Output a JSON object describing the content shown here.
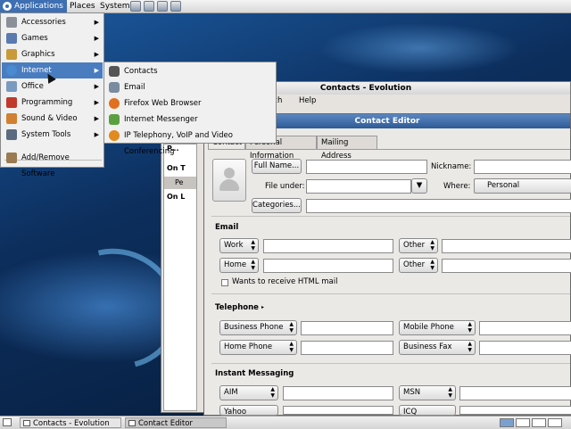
{
  "top_panel": {
    "menus": [
      "Applications",
      "Places",
      "System"
    ]
  },
  "applications_menu": {
    "items": [
      {
        "label": "Accessories",
        "icon": "accessories-icon",
        "color": "#8a8f99"
      },
      {
        "label": "Games",
        "icon": "games-icon",
        "color": "#5a7ab0"
      },
      {
        "label": "Graphics",
        "icon": "graphics-icon",
        "color": "#c89a3a"
      },
      {
        "label": "Internet",
        "icon": "globe-icon",
        "color": "#4a8ad0"
      },
      {
        "label": "Office",
        "icon": "office-icon",
        "color": "#7a9ac0"
      },
      {
        "label": "Programming",
        "icon": "programming-icon",
        "color": "#c0392b"
      },
      {
        "label": "Sound & Video",
        "icon": "sound-video-icon",
        "color": "#d08030"
      },
      {
        "label": "System Tools",
        "icon": "system-tools-icon",
        "color": "#5a6a80"
      },
      {
        "label": "Add/Remove Software",
        "icon": "package-icon",
        "color": "#9a7a50"
      }
    ],
    "highlighted": "Internet"
  },
  "internet_menu": {
    "items": [
      {
        "label": "Contacts",
        "icon": "contacts-icon",
        "color": "#555555"
      },
      {
        "label": "Email",
        "icon": "email-icon",
        "color": "#7a8aa0"
      },
      {
        "label": "Firefox Web Browser",
        "icon": "firefox-icon",
        "color": "#e07020"
      },
      {
        "label": "Internet Messenger",
        "icon": "messenger-icon",
        "color": "#5aa040"
      },
      {
        "label": "IP Telephony, VoIP and Video Conferencing",
        "icon": "telephony-icon",
        "color": "#e08a20"
      }
    ]
  },
  "evolution_window": {
    "title": "Contacts - Evolution",
    "menus": [
      "rch",
      "Help"
    ],
    "side_rows": [
      "P...",
      "On T",
      "Pe",
      "On L"
    ]
  },
  "contact_editor": {
    "title": "Contact Editor",
    "tabs": [
      "Contact",
      "Personal Information",
      "Mailing Address"
    ],
    "full_name_button": "Full Name...",
    "nickname_label": "Nickname:",
    "file_under_label": "File under:",
    "where_label": "Where:",
    "where_value": "Personal",
    "categories_button": "Categories...",
    "email": {
      "heading": "Email",
      "rows": [
        {
          "left_type": "Work",
          "right_type": "Other"
        },
        {
          "left_type": "Home",
          "right_type": "Other"
        }
      ],
      "html_checkbox_label": "Wants to receive HTML mail"
    },
    "telephone": {
      "heading": "Telephone",
      "rows": [
        {
          "left_type": "Business Phone",
          "right_type": "Mobile Phone"
        },
        {
          "left_type": "Home Phone",
          "right_type": "Business Fax"
        }
      ]
    },
    "instant_messaging": {
      "heading": "Instant Messaging",
      "rows": [
        {
          "left_type": "AIM",
          "right_type": "MSN"
        },
        {
          "left_type": "Yahoo",
          "right_type": "ICQ"
        }
      ]
    }
  },
  "bottom_panel": {
    "tasks": [
      "Contacts - Evolution",
      "Contact Editor"
    ]
  }
}
